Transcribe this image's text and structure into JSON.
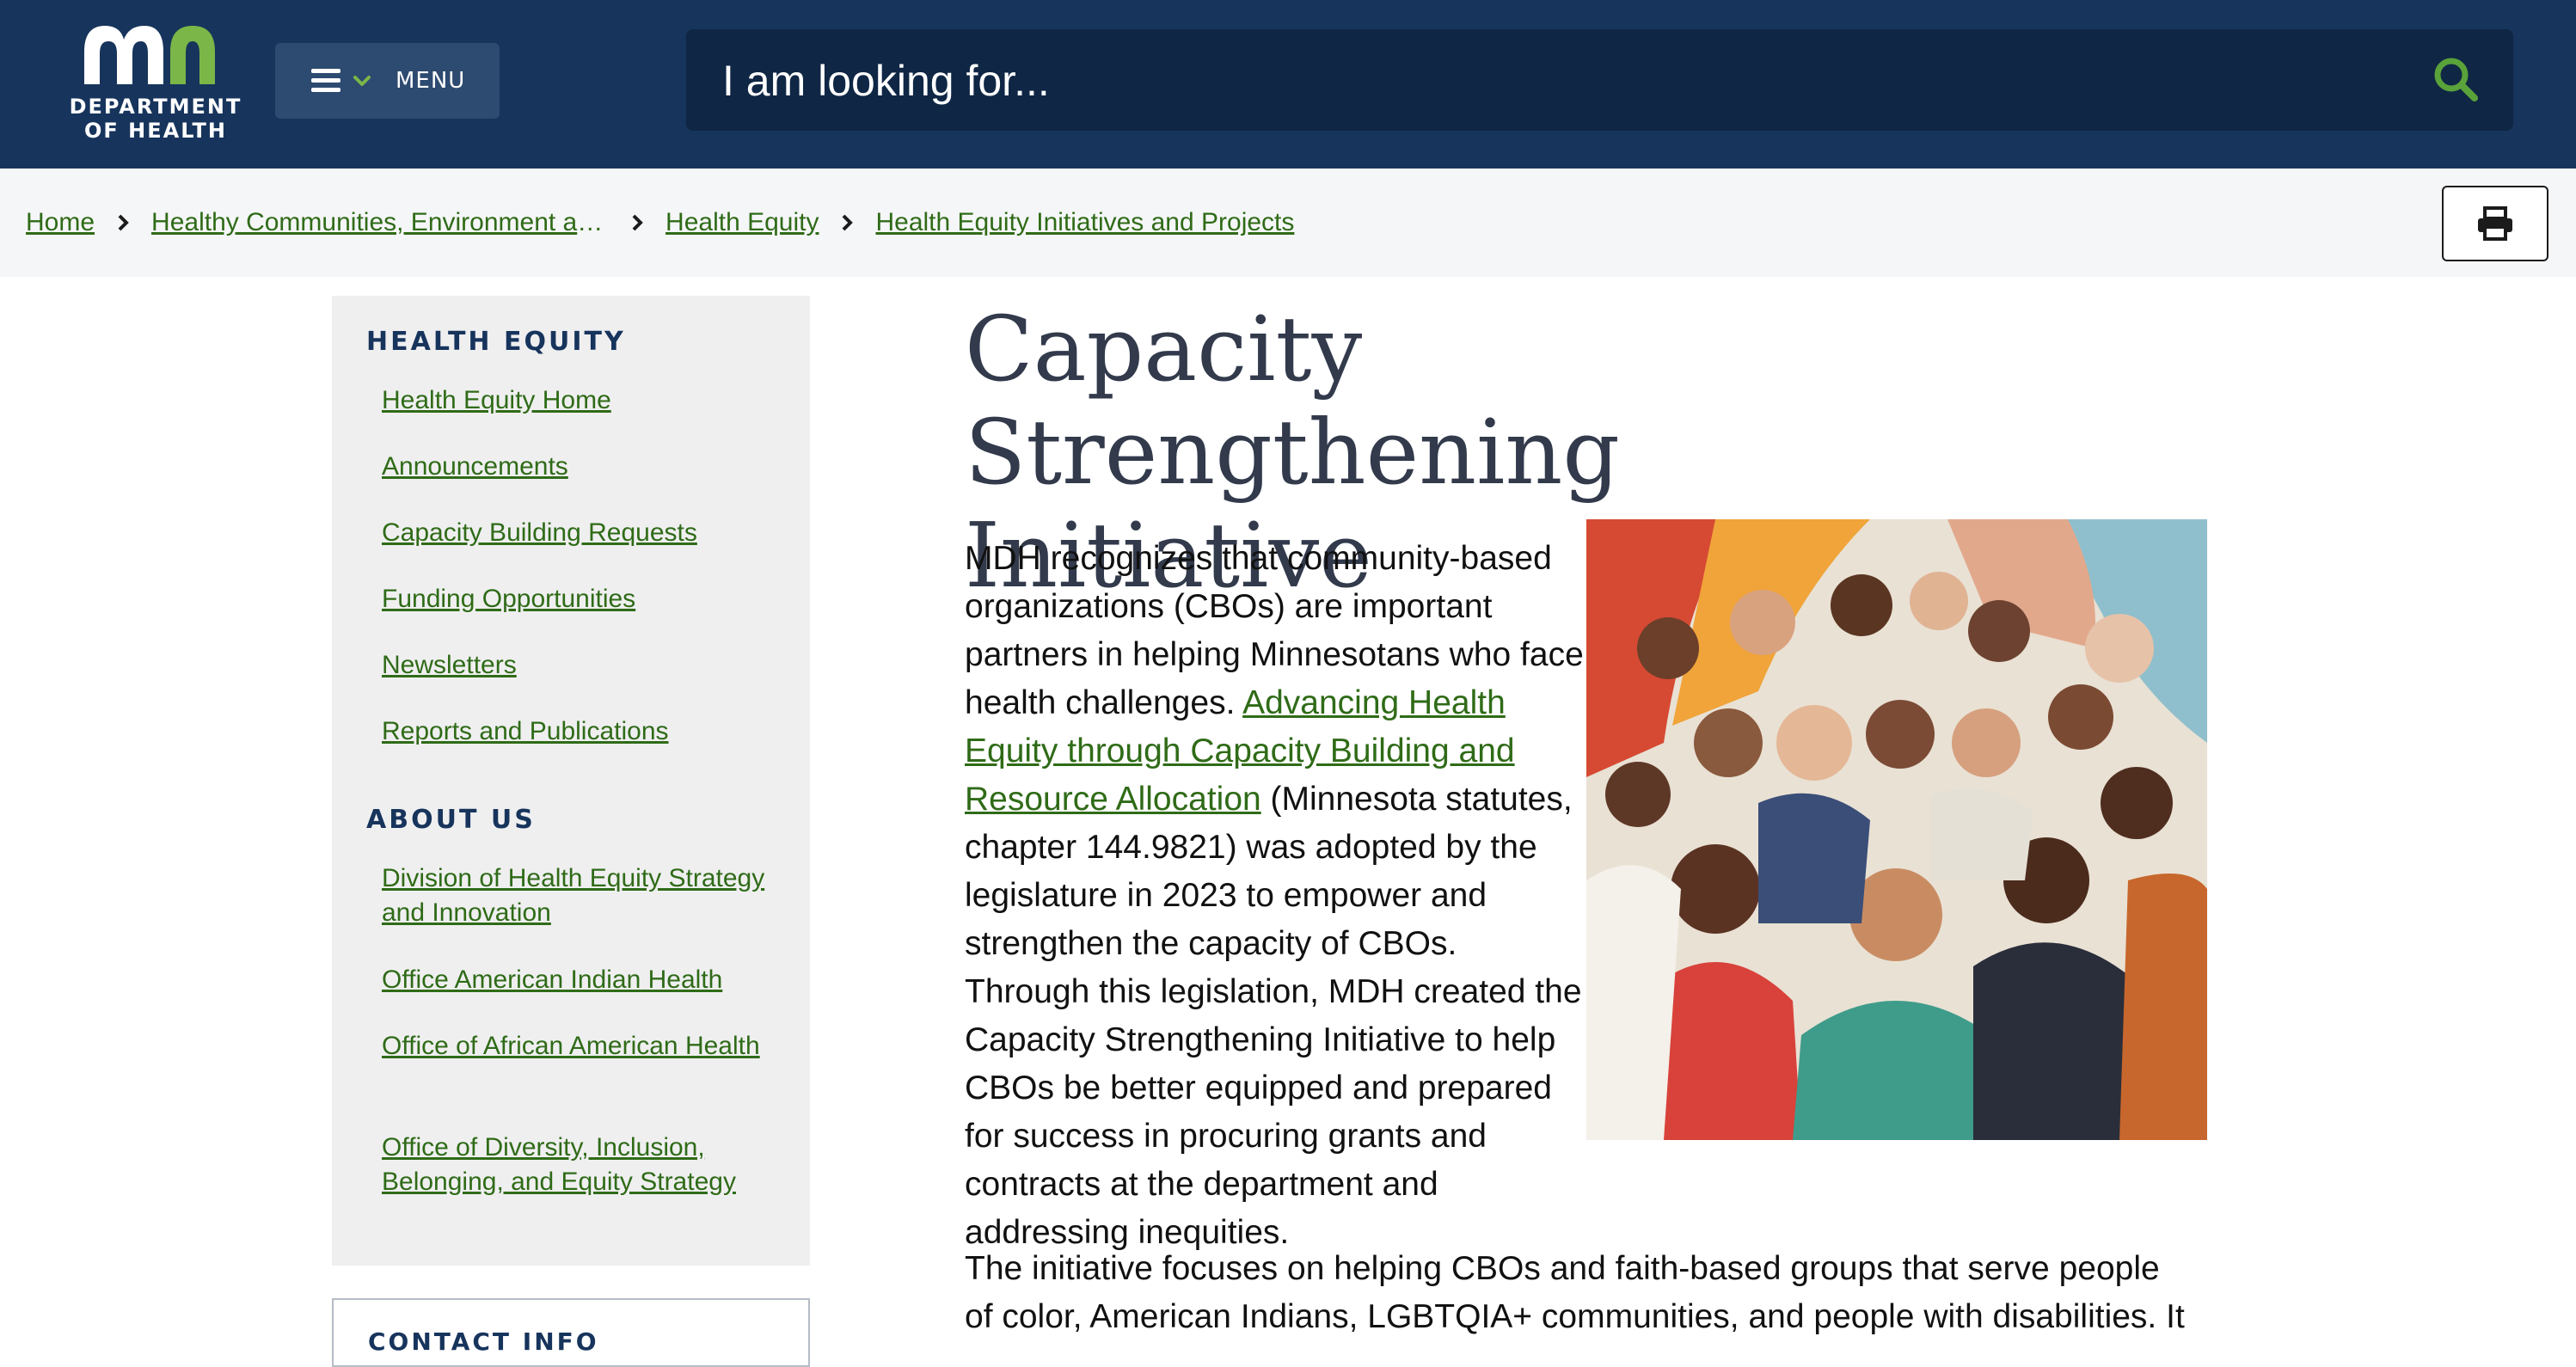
{
  "header": {
    "logo_text": "DEPARTMENT OF HEALTH",
    "menu_label": "MENU",
    "search_placeholder": "I am looking for..."
  },
  "breadcrumb": [
    "Home",
    "Healthy Communities, Environment and Workplaces",
    "Health Equity",
    "Health Equity Initiatives and Projects"
  ],
  "sidebar": {
    "section1_title": "HEALTH EQUITY",
    "section1_items": [
      "Health Equity Home",
      "Announcements",
      "Capacity Building Requests",
      "Funding Opportunities",
      "Newsletters",
      "Reports and Publications"
    ],
    "section2_title": "ABOUT US",
    "section2_items": [
      "Division of Health Equity Strategy and Innovation",
      "Office American Indian Health",
      "Office of African American Health",
      "Office of Diversity, Inclusion, Belonging, and Equity Strategy"
    ],
    "contact_title": "CONTACT INFO"
  },
  "main": {
    "title": "Capacity Strengthening Initiative",
    "para1_before": "MDH recognizes that community-based organizations (CBOs) are important partners in helping Minnesotans who face health challenges. ",
    "para1_link": "Advancing Health Equity through Capacity Building and Resource Allocation",
    "para1_after": " (Minnesota statutes, chapter 144.9821) was adopted by the legislature in 2023 to empower and strengthen the capacity of CBOs. Through this legislation, MDH created the Capacity Strengthening Initiative to help CBOs be better equipped and prepared for success in procuring grants and contracts at the department and addressing inequities.",
    "para2": "The initiative focuses on helping CBOs and faith-based groups that serve people of color, American Indians, LGBTQIA+ communities, and people with disabilities. It"
  },
  "colors": {
    "header_bg": "#17345c",
    "search_bg": "#0f2645",
    "link_green": "#2f6b17",
    "logo_green": "#7ab648"
  },
  "icons": [
    "hamburger-icon",
    "chevron-down-icon",
    "search-icon",
    "chevron-right-icon",
    "printer-icon"
  ]
}
